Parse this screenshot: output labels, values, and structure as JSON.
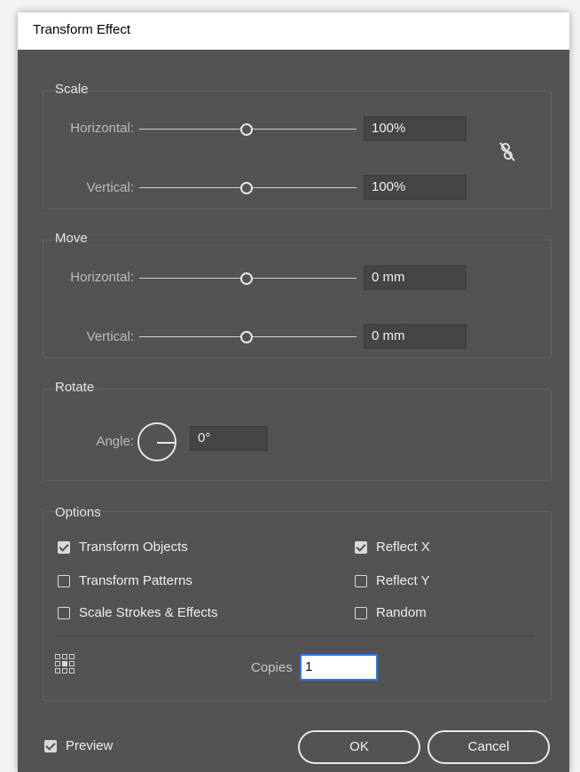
{
  "dialog": {
    "title": "Transform Effect"
  },
  "scale": {
    "title": "Scale",
    "horizontal_label": "Horizontal:",
    "horizontal_value": "100%",
    "vertical_label": "Vertical:",
    "vertical_value": "100%"
  },
  "move": {
    "title": "Move",
    "horizontal_label": "Horizontal:",
    "horizontal_value": "0 mm",
    "vertical_label": "Vertical:",
    "vertical_value": "0 mm"
  },
  "rotate": {
    "title": "Rotate",
    "angle_label": "Angle:",
    "angle_value": "0°"
  },
  "options": {
    "title": "Options",
    "transform_objects": {
      "label": "Transform Objects",
      "checked": true
    },
    "transform_patterns": {
      "label": "Transform Patterns",
      "checked": false
    },
    "scale_strokes": {
      "label": "Scale Strokes & Effects",
      "checked": false
    },
    "reflect_x": {
      "label": "Reflect X",
      "checked": true
    },
    "reflect_y": {
      "label": "Reflect Y",
      "checked": false
    },
    "random": {
      "label": "Random",
      "checked": false
    },
    "copies_label": "Copies",
    "copies_value": "1"
  },
  "footer": {
    "preview": {
      "label": "Preview",
      "checked": true
    },
    "ok_label": "OK",
    "cancel_label": "Cancel"
  },
  "icons": {
    "constrain": "unlink-proportions-icon",
    "reference_point": "reference-point-grid-icon"
  },
  "colors": {
    "panel": "#535353",
    "focus": "#2a7be6"
  }
}
